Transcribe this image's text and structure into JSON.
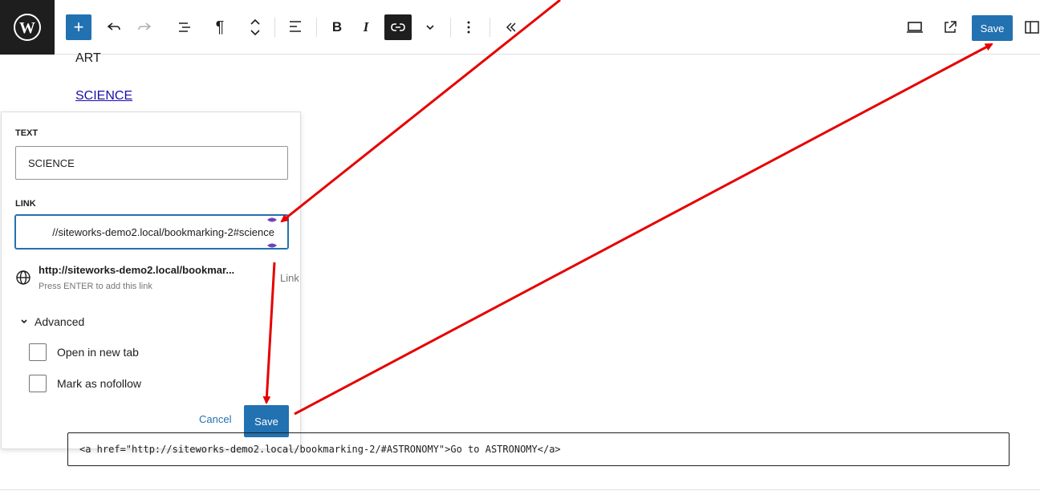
{
  "toolbar": {
    "add_label": "+",
    "save_label": "Save",
    "icons": [
      "wordpress-logo",
      "add-block",
      "undo",
      "redo",
      "list-view",
      "paragraph",
      "move-up-down",
      "align",
      "bold",
      "italic",
      "link",
      "more-rich-text",
      "options",
      "collapse",
      "preview-desktop",
      "view-external",
      "settings-panel"
    ],
    "bold_label": "B",
    "italic_label": "I",
    "paragraph_label": "¶"
  },
  "content": {
    "art": "ART",
    "science": "SCIENCE",
    "code": "<a href=\"http://siteworks-demo2.local/bookmarking-2/#ASTRONOMY\">Go to ASTRONOMY</a>"
  },
  "link_popover": {
    "text_label": "TEXT",
    "text_value": "SCIENCE",
    "link_label": "LINK",
    "link_value": "//siteworks-demo2.local/bookmarking-2#science",
    "suggestion_title": "http://siteworks-demo2.local/bookmar...",
    "suggestion_sub": "Press ENTER to add this link",
    "suggestion_type": "Link",
    "advanced_label": "Advanced",
    "new_tab_label": "Open in new tab",
    "nofollow_label": "Mark as nofollow",
    "cancel_label": "Cancel",
    "save_label": "Save"
  },
  "colors": {
    "accent": "#2271b1",
    "annotation": "#e60000"
  }
}
